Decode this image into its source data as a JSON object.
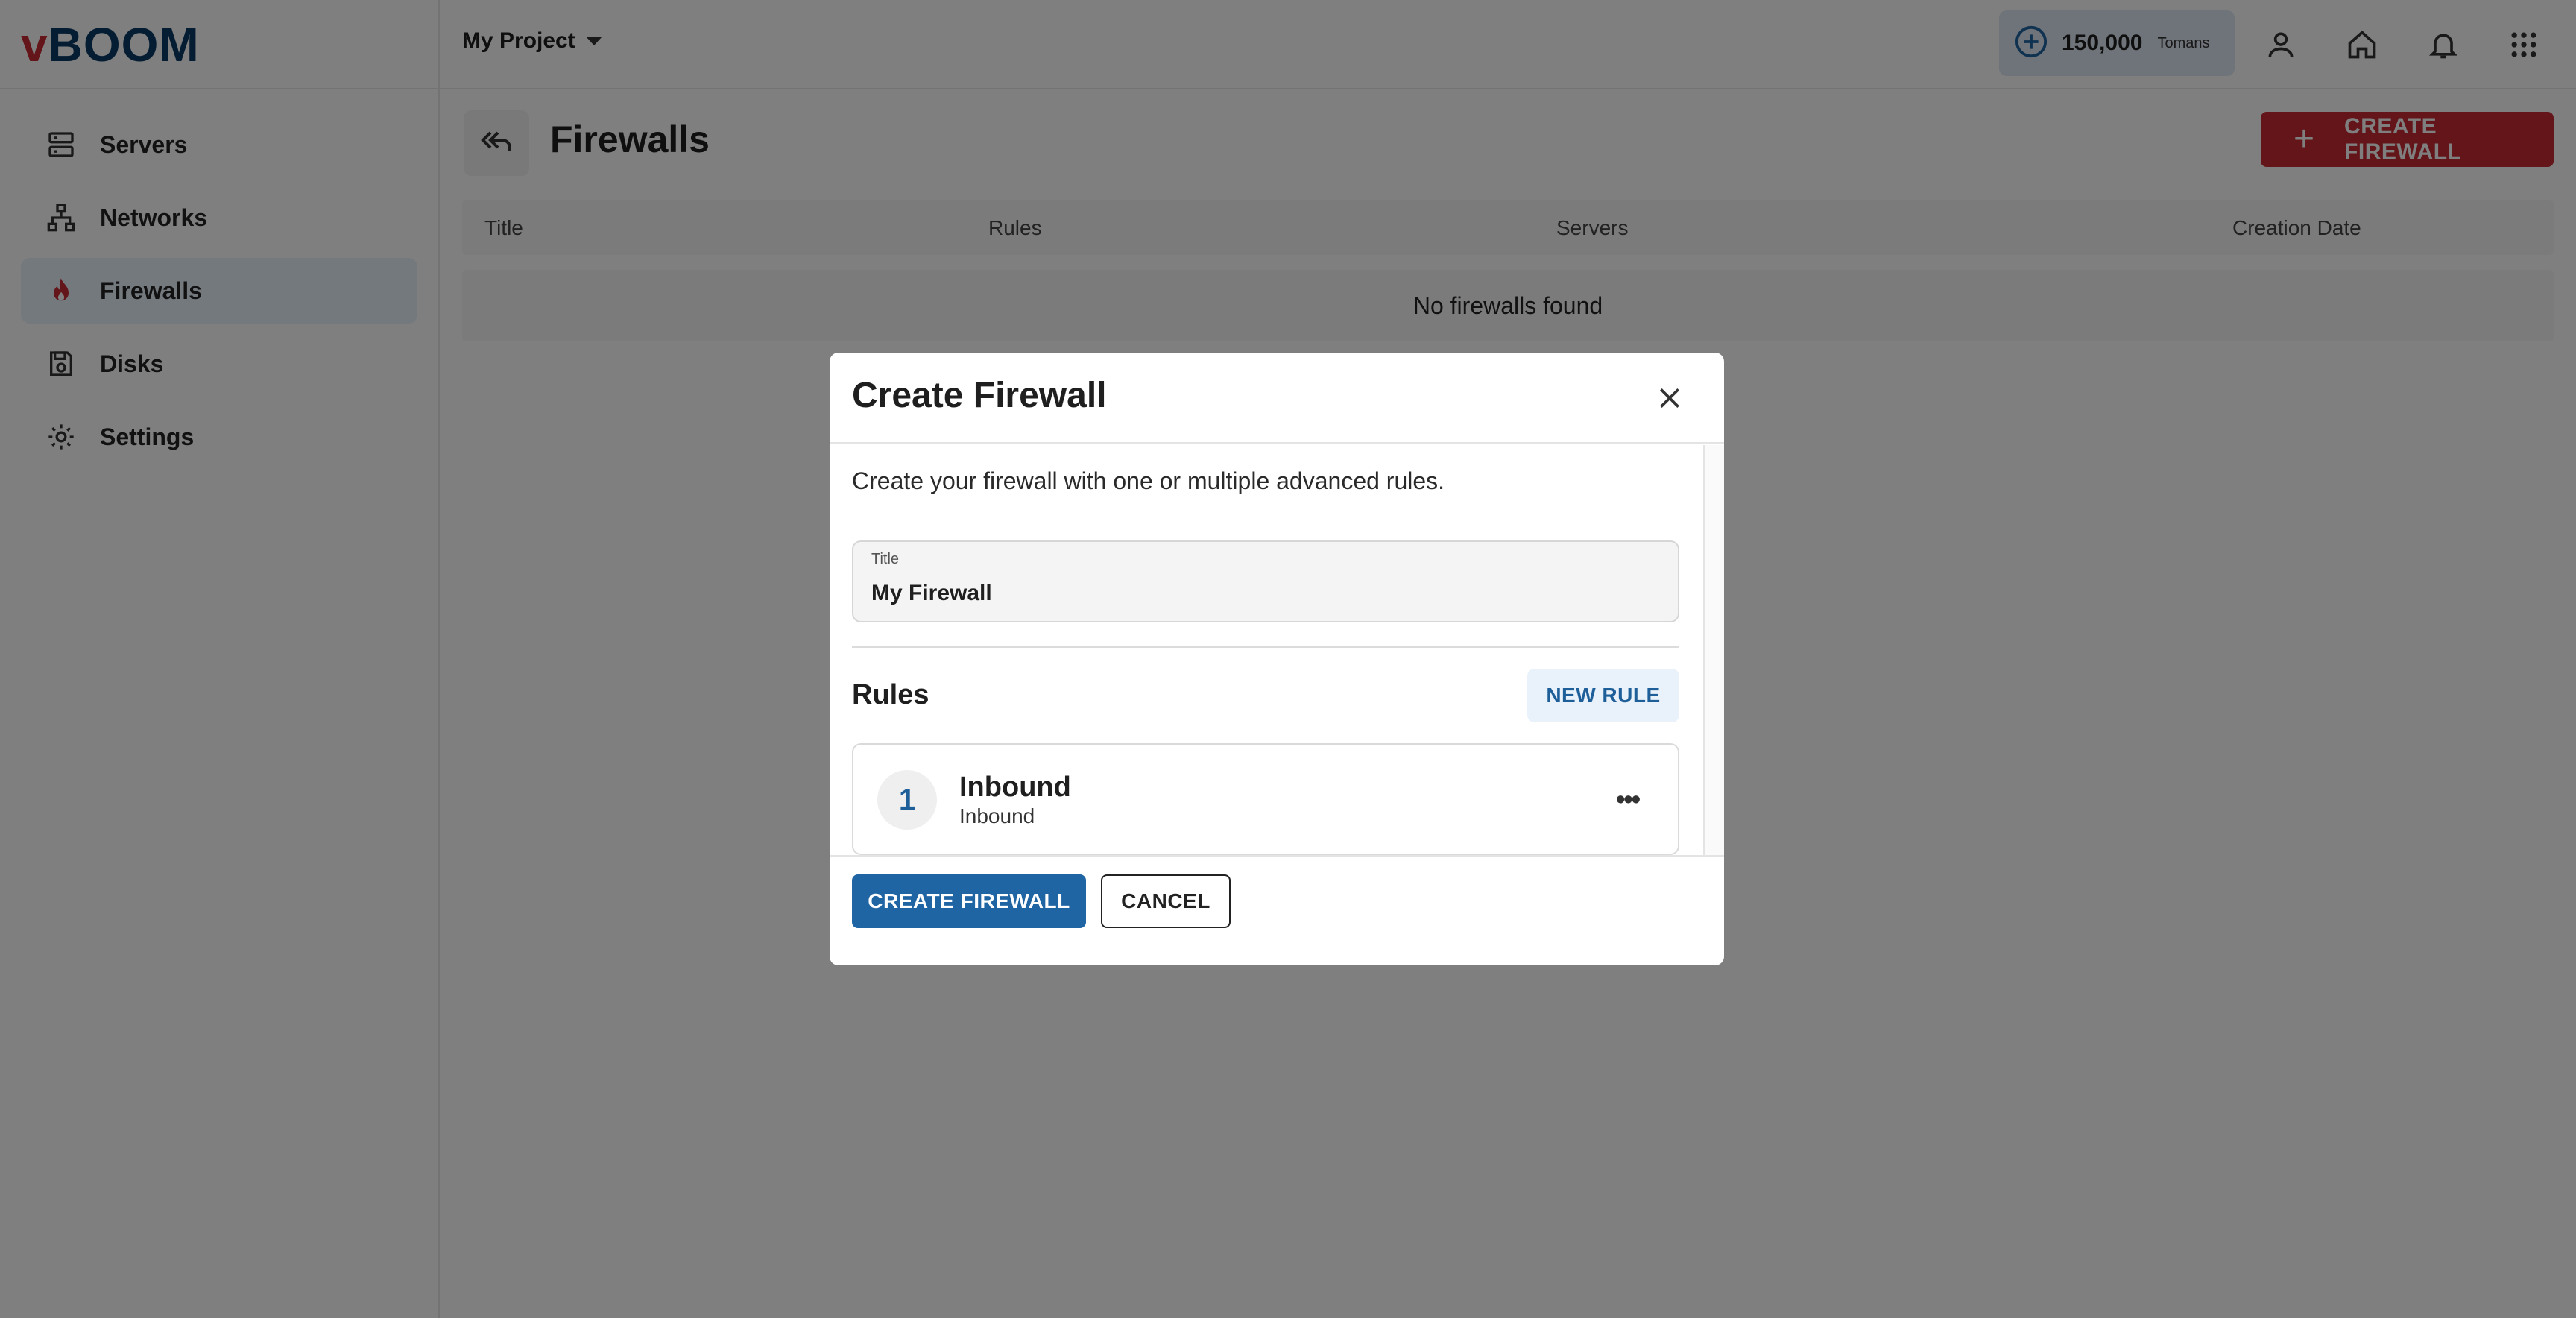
{
  "app": {
    "logo_v": "v",
    "logo_rest": "BOOM"
  },
  "sidebar": {
    "items": [
      {
        "label": "Servers",
        "icon": "server-icon",
        "active": false
      },
      {
        "label": "Networks",
        "icon": "network-icon",
        "active": false
      },
      {
        "label": "Firewalls",
        "icon": "flame-icon",
        "active": true
      },
      {
        "label": "Disks",
        "icon": "disk-icon",
        "active": false
      },
      {
        "label": "Settings",
        "icon": "gear-icon",
        "active": false
      }
    ]
  },
  "header": {
    "project": "My Project",
    "balance_amount": "150,000",
    "balance_currency": "Tomans",
    "icons": [
      "add-credit-icon",
      "user-icon",
      "home-icon",
      "bell-icon",
      "apps-grid-icon"
    ]
  },
  "main": {
    "title": "Firewalls",
    "create_label": "CREATE FIREWALL",
    "table": {
      "columns": [
        "Title",
        "Rules",
        "Servers",
        "Creation Date"
      ],
      "empty_text": "No firewalls found"
    }
  },
  "modal": {
    "title": "Create Firewall",
    "description": "Create your firewall with one or multiple advanced rules.",
    "field_label": "Title",
    "field_value": "My Firewall",
    "rules_title": "Rules",
    "new_rule_label": "NEW RULE",
    "rules": [
      {
        "number": "1",
        "name": "Inbound",
        "direction": "Inbound"
      }
    ],
    "submit_label": "CREATE FIREWALL",
    "cancel_label": "CANCEL"
  },
  "colors": {
    "brand_red": "#c62b33",
    "brand_blue": "#1f64a3",
    "logo_navy": "#0b3a66",
    "overlay": "rgba(0,0,0,0.5)"
  }
}
